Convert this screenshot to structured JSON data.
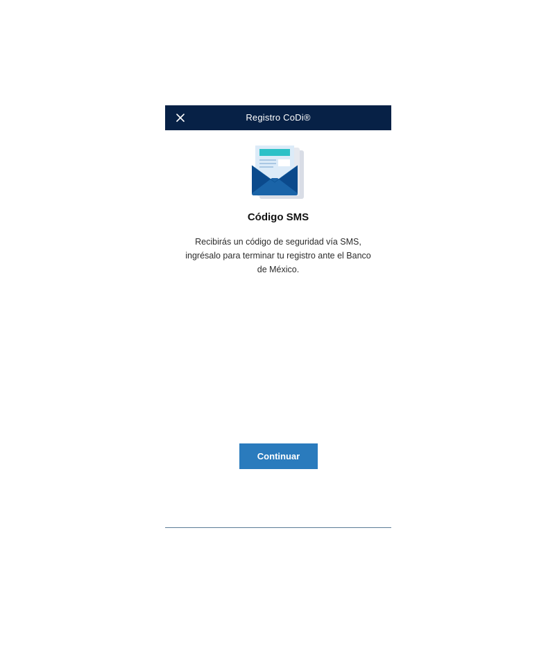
{
  "header": {
    "title": "Registro CoDi®",
    "close_icon": "close-icon"
  },
  "illustration": {
    "icon": "envelope-document-icon"
  },
  "content": {
    "title": "Código SMS",
    "description": "Recibirás un código de seguridad vía SMS, ingrésalo para terminar tu registro ante el Banco de México."
  },
  "actions": {
    "continue_label": "Continuar"
  },
  "colors": {
    "header_bg": "#072146",
    "primary_button": "#2a7bbd",
    "envelope_dark": "#0b4a8c",
    "envelope_light": "#1a64a8",
    "accent_teal": "#2dc1c7"
  }
}
